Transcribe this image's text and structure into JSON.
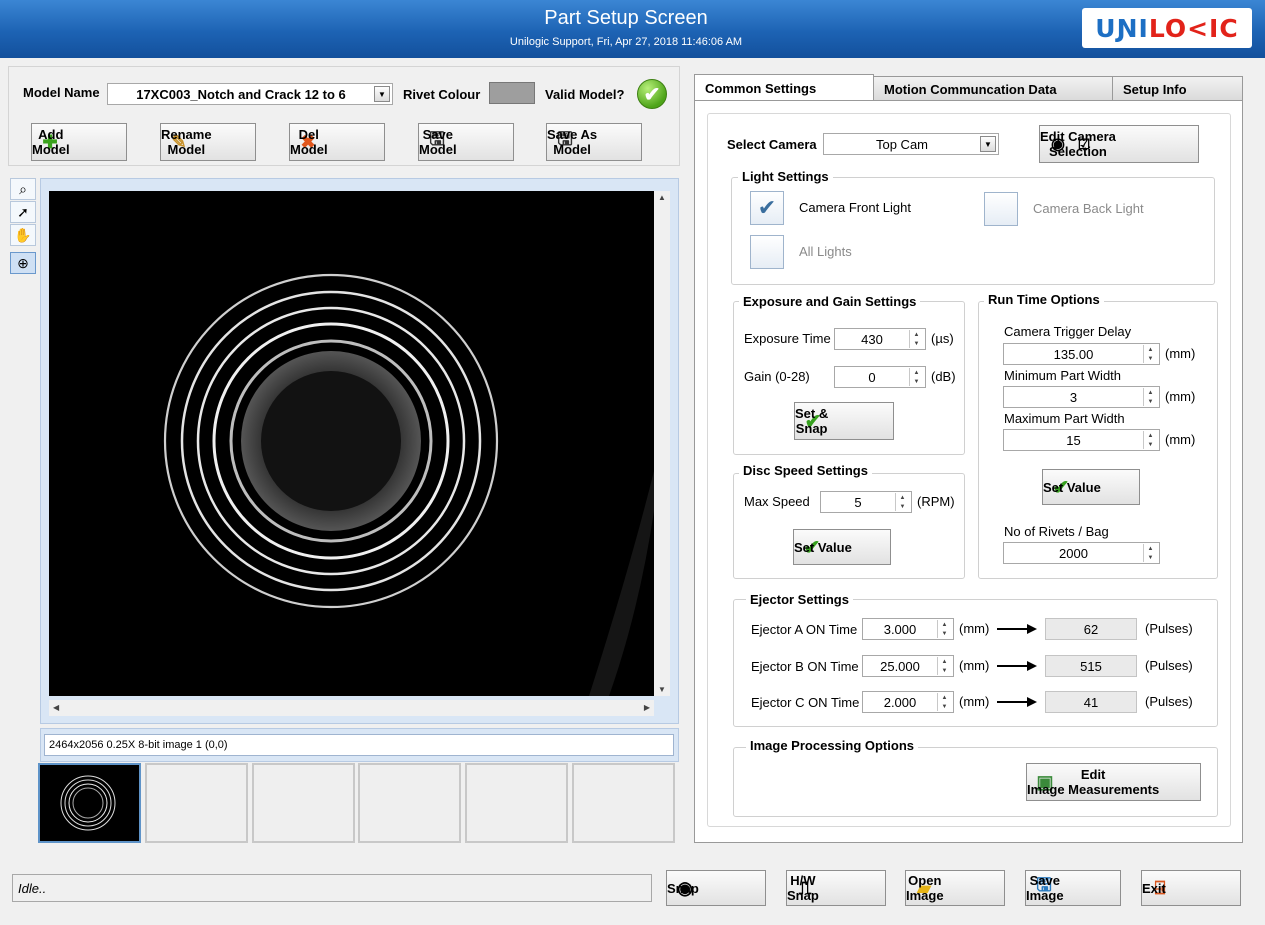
{
  "header": {
    "title": "Part Setup Screen",
    "subtitle": "Unilogic Support, Fri, Apr 27, 2018 11:46:06 AM",
    "logo_part1": "UNI",
    "logo_part2": "LO<IC"
  },
  "model": {
    "name_label": "Model Name",
    "name_value": "17XC003_Notch and Crack 12 to 6",
    "rivet_colour_label": "Rivet Colour",
    "rivet_colour": "#9e9e9e",
    "valid_label": "Valid Model?"
  },
  "model_buttons": {
    "add": "Add\nModel",
    "rename": "Rename\nModel",
    "del": "Del\nModel",
    "save": "Save\nModel",
    "save_as": "Save As\nModel"
  },
  "viewer": {
    "image_info": "2464x2056 0.25X 8-bit image 1    (0,0)"
  },
  "tabs": [
    "Common Settings",
    "Motion Communcation Data",
    "Setup Info"
  ],
  "camera": {
    "select_label": "Select Camera",
    "selected": "Top Cam",
    "edit_button": "Edit Camera\nSelection"
  },
  "light": {
    "title": "Light Settings",
    "front": "Camera Front Light",
    "back": "Camera Back Light",
    "all": "All Lights",
    "front_checked": true
  },
  "exposure": {
    "title": "Exposure and Gain Settings",
    "exposure_label": "Exposure Time",
    "exposure_value": "430",
    "exposure_unit": "(µs)",
    "gain_label": "Gain (0-28)",
    "gain_value": "0",
    "gain_unit": "(dB)",
    "set_snap": "Set &\nSnap"
  },
  "disc": {
    "title": "Disc Speed Settings",
    "max_label": "Max Speed",
    "max_value": "5",
    "max_unit": "(RPM)",
    "set_value": "Set Value"
  },
  "runtime": {
    "title": "Run Time Options",
    "delay_label": "Camera Trigger Delay",
    "delay_value": "135.00",
    "min_label": "Minimum Part Width",
    "min_value": "3",
    "max_label": "Maximum Part Width",
    "max_value": "15",
    "unit": "(mm)",
    "set_value": "Set Value",
    "rivets_label": "No of Rivets / Bag",
    "rivets_value": "2000"
  },
  "ejector": {
    "title": "Ejector Settings",
    "rows": [
      {
        "label": "Ejector A ON Time",
        "value": "3.000",
        "unit": "(mm)",
        "pulses": "62",
        "pulses_unit": "(Pulses)"
      },
      {
        "label": "Ejector B ON Time",
        "value": "25.000",
        "unit": "(mm)",
        "pulses": "515",
        "pulses_unit": "(Pulses)"
      },
      {
        "label": "Ejector C ON Time",
        "value": "2.000",
        "unit": "(mm)",
        "pulses": "41",
        "pulses_unit": "(Pulses)"
      }
    ]
  },
  "image_processing": {
    "title": "Image Processing Options",
    "button": "Edit\nImage Measurements"
  },
  "status": "Idle..",
  "bottom_buttons": {
    "snap": "Snap",
    "hw_snap": "H/W\nSnap",
    "open": "Open\nImage",
    "save": "Save\nImage",
    "exit": "Exit"
  }
}
